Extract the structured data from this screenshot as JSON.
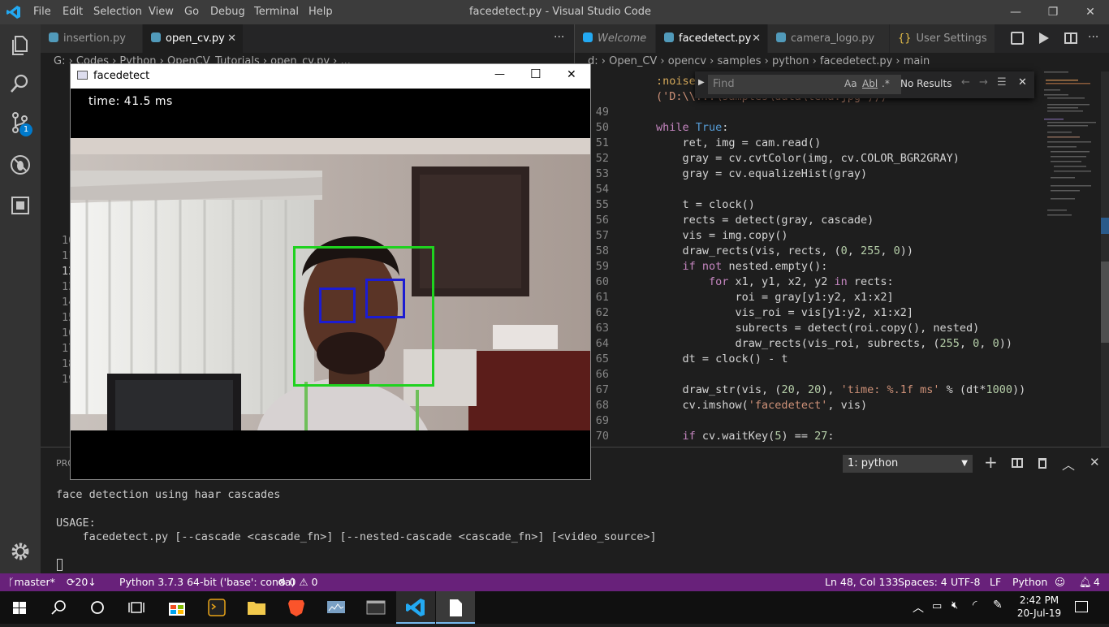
{
  "window": {
    "title": "facedetect.py - Visual Studio Code",
    "menu": [
      "File",
      "Edit",
      "Selection",
      "View",
      "Go",
      "Debug",
      "Terminal",
      "Help"
    ],
    "min": "—",
    "max": "❐",
    "close": "✕"
  },
  "activity": {
    "scm_badge": "1"
  },
  "left_group": {
    "tabs": [
      {
        "label": "insertion.py"
      },
      {
        "label": "open_cv.py",
        "close": "✕"
      }
    ],
    "more": "···",
    "breadcrumb": "G: › Codes › Python › OpenCV_Tutorials › open_cv.py › ...",
    "line_numbers": [
      "10",
      "11",
      "12",
      "13",
      "14",
      "15",
      "16",
      "17",
      "18",
      "19"
    ]
  },
  "right_group": {
    "tabs": [
      {
        "label": "Welcome"
      },
      {
        "label": "facedetect.py",
        "close": "✕"
      },
      {
        "label": "camera_logo.py"
      },
      {
        "label": "User Settings"
      }
    ],
    "breadcrumb": "d: › Open_CV › opencv › samples › python › facedetect.py › main",
    "code": [
      {
        "n": "",
        "t": ":noise"
      },
      {
        "n": "",
        "t": "('D:\\\\...\\samples\\data\\lena.jpg')))"
      },
      {
        "n": "49",
        "t": ""
      },
      {
        "n": "50",
        "t": "while True:"
      },
      {
        "n": "51",
        "t": "    ret, img = cam.read()"
      },
      {
        "n": "52",
        "t": "    gray = cv.cvtColor(img, cv.COLOR_BGR2GRAY)"
      },
      {
        "n": "53",
        "t": "    gray = cv.equalizeHist(gray)"
      },
      {
        "n": "54",
        "t": ""
      },
      {
        "n": "55",
        "t": "    t = clock()"
      },
      {
        "n": "56",
        "t": "    rects = detect(gray, cascade)"
      },
      {
        "n": "57",
        "t": "    vis = img.copy()"
      },
      {
        "n": "58",
        "t": "    draw_rects(vis, rects, (0, 255, 0))"
      },
      {
        "n": "59",
        "t": "    if not nested.empty():"
      },
      {
        "n": "60",
        "t": "        for x1, y1, x2, y2 in rects:"
      },
      {
        "n": "61",
        "t": "            roi = gray[y1:y2, x1:x2]"
      },
      {
        "n": "62",
        "t": "            vis_roi = vis[y1:y2, x1:x2]"
      },
      {
        "n": "63",
        "t": "            subrects = detect(roi.copy(), nested)"
      },
      {
        "n": "64",
        "t": "            draw_rects(vis_roi, subrects, (255, 0, 0))"
      },
      {
        "n": "65",
        "t": "    dt = clock() - t"
      },
      {
        "n": "66",
        "t": ""
      },
      {
        "n": "67",
        "t": "    draw_str(vis, (20, 20), 'time: %.1f ms' % (dt*1000))"
      },
      {
        "n": "68",
        "t": "    cv.imshow('facedetect', vis)"
      },
      {
        "n": "69",
        "t": ""
      },
      {
        "n": "70",
        "t": "    if cv.waitKey(5) == 27:"
      }
    ]
  },
  "find": {
    "placeholder": "Find",
    "aa": "Aa",
    "ab": "Abl",
    "re": ".*",
    "result": "No Results"
  },
  "panel": {
    "tab_hint": "PRO",
    "terminal_select": "1: python",
    "lines": [
      "face detection using haar cascades",
      "",
      "USAGE:",
      "    facedetect.py [--cascade <cascade_fn>] [--nested-cascade <cascade_fn>] [<video_source>]"
    ]
  },
  "status": {
    "branch": "master*",
    "sync": "20↓ 0↑",
    "interpreter": "Python 3.7.3 64-bit ('base': conda)",
    "problems": "⊗ 0 ⚠ 0",
    "position": "Ln 48, Col 133",
    "spaces": "Spaces: 4",
    "encoding": "UTF-8",
    "eol": "LF",
    "language": "Python",
    "bell": "4"
  },
  "facedetect_window": {
    "title": "facedetect",
    "overlay": "time: 41.5 ms",
    "min": "—",
    "max": "☐",
    "close": "✕"
  },
  "taskbar": {
    "time": "2:42 PM",
    "date": "20-Jul-19"
  },
  "colors": {
    "accent": "#007acc",
    "status": "#68217a",
    "face_rect": "#1fd21f",
    "eye_rect": "#1c1cd2"
  }
}
